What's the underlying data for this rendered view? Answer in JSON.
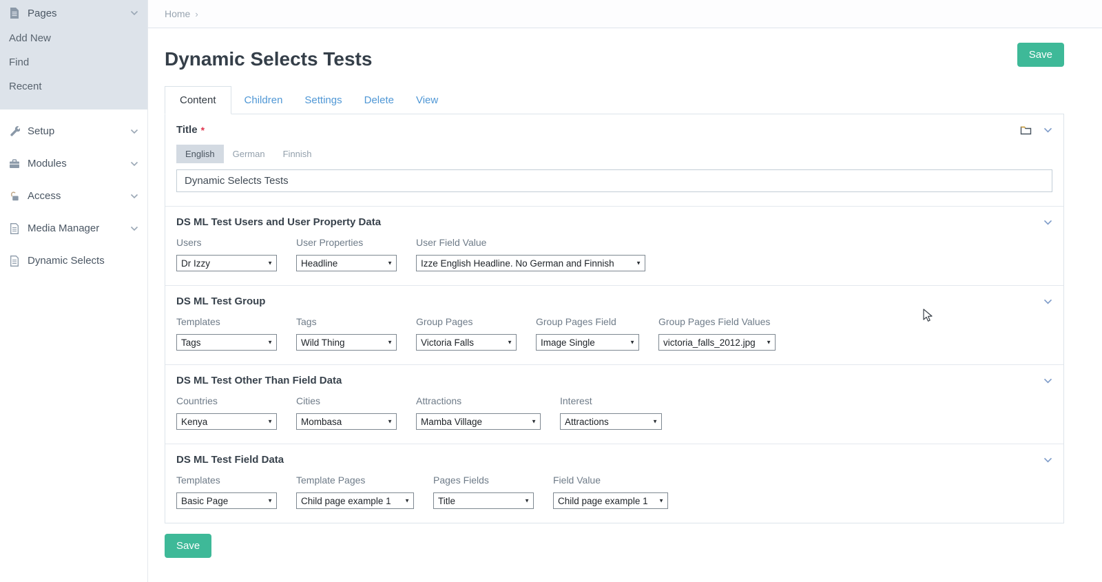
{
  "colors": {
    "accent_green": "#3eb998",
    "link_blue": "#4f97d5",
    "required_red": "#e0364f",
    "active_nav_bg": "#dde3ea"
  },
  "sidebar": {
    "pages": {
      "label": "Pages",
      "items": [
        "Add New",
        "Find",
        "Recent"
      ]
    },
    "items": [
      {
        "label": "Setup"
      },
      {
        "label": "Modules"
      },
      {
        "label": "Access"
      },
      {
        "label": "Media Manager"
      },
      {
        "label": "Dynamic Selects"
      }
    ]
  },
  "breadcrumb": {
    "home": "Home",
    "separator": "›"
  },
  "header": {
    "title": "Dynamic Selects Tests",
    "save_label": "Save"
  },
  "tabs": [
    {
      "label": "Content",
      "active": true
    },
    {
      "label": "Children"
    },
    {
      "label": "Settings"
    },
    {
      "label": "Delete"
    },
    {
      "label": "View"
    }
  ],
  "title_field": {
    "label": "Title",
    "required_mark": "*",
    "languages": [
      {
        "label": "English",
        "active": true
      },
      {
        "label": "German"
      },
      {
        "label": "Finnish"
      }
    ],
    "value": "Dynamic Selects Tests"
  },
  "select_arrow": "▼",
  "fieldsets": [
    {
      "title": "DS ML Test Users and User Property Data",
      "fields": [
        {
          "label": "Users",
          "value": "Dr Izzy"
        },
        {
          "label": "User Properties",
          "value": "Headline"
        },
        {
          "label": "User Field Value",
          "value": "Izze English Headline. No German and Finnish"
        }
      ]
    },
    {
      "title": "DS ML Test Group",
      "fields": [
        {
          "label": "Templates",
          "value": "Tags"
        },
        {
          "label": "Tags",
          "value": "Wild Thing"
        },
        {
          "label": "Group Pages",
          "value": "Victoria Falls"
        },
        {
          "label": "Group Pages Field",
          "value": "Image Single"
        },
        {
          "label": "Group Pages Field Values",
          "value": "victoria_falls_2012.jpg"
        }
      ]
    },
    {
      "title": "DS ML Test Other Than Field Data",
      "fields": [
        {
          "label": "Countries",
          "value": "Kenya"
        },
        {
          "label": "Cities",
          "value": "Mombasa"
        },
        {
          "label": "Attractions",
          "value": "Mamba Village"
        },
        {
          "label": "Interest",
          "value": "Attractions"
        }
      ]
    },
    {
      "title": "DS ML Test Field Data",
      "fields": [
        {
          "label": "Templates",
          "value": "Basic Page"
        },
        {
          "label": "Template Pages",
          "value": "Child page example 1"
        },
        {
          "label": "Pages Fields",
          "value": "Title"
        },
        {
          "label": "Field Value",
          "value": "Child page example 1"
        }
      ]
    }
  ],
  "footer": {
    "save_label": "Save"
  }
}
